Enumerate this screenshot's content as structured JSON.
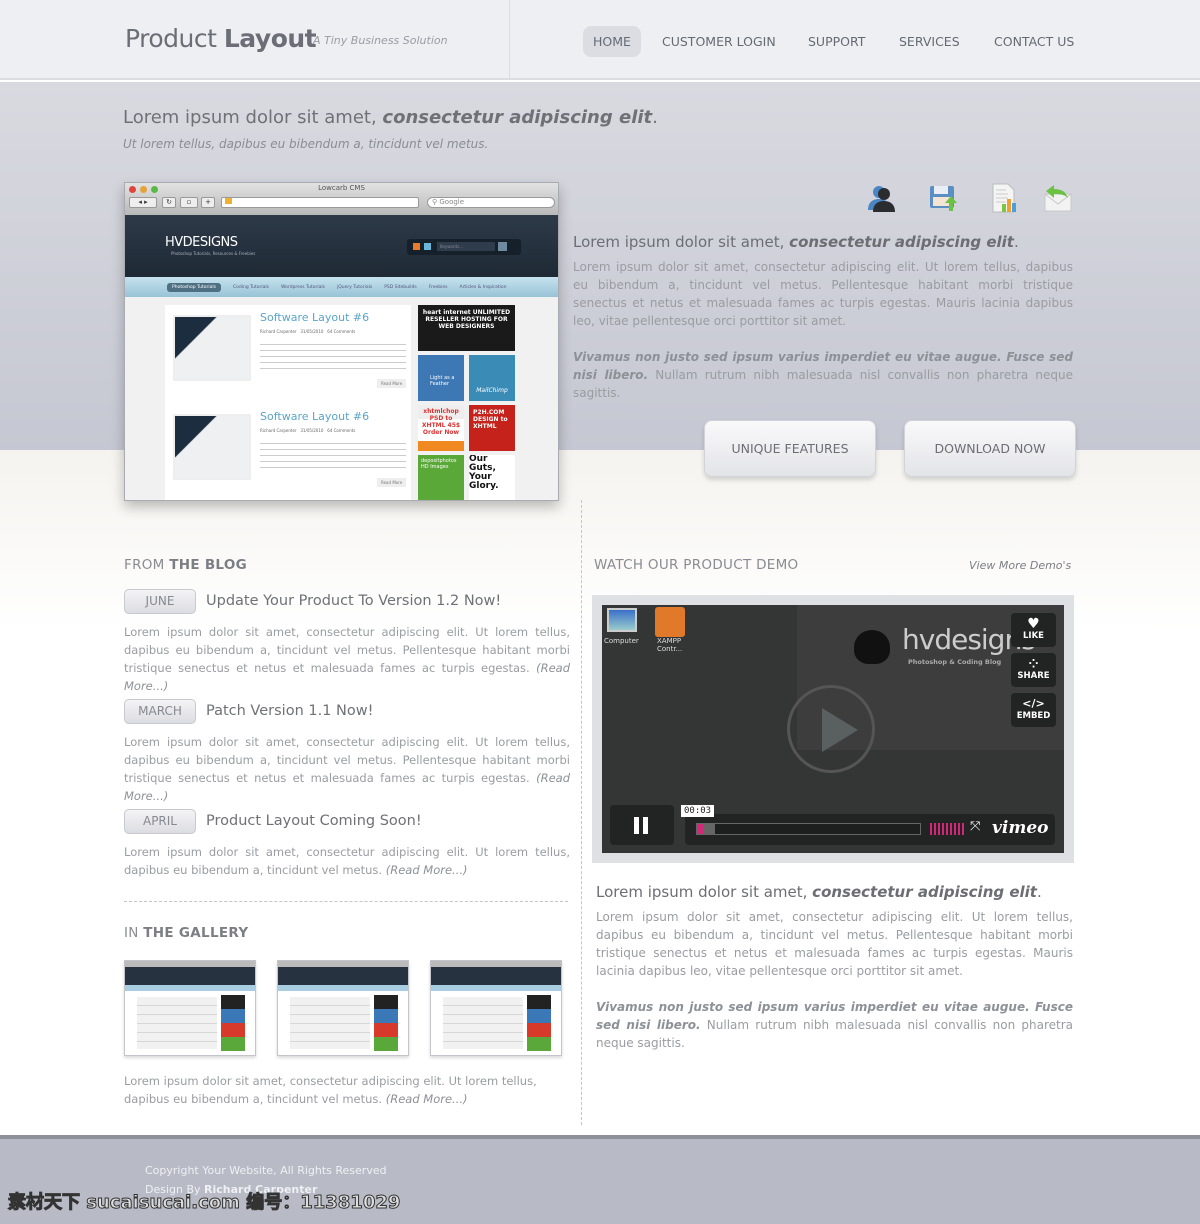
{
  "header": {
    "logo_light": "Product",
    "logo_bold": "Layout",
    "tagline": "A Tiny Business Solution",
    "nav": [
      {
        "label": "HOME",
        "active": true
      },
      {
        "label": "CUSTOMER LOGIN"
      },
      {
        "label": "SUPPORT"
      },
      {
        "label": "SERVICES"
      },
      {
        "label": "CONTACT US"
      }
    ]
  },
  "hero": {
    "headline_plain": "Lorem ipsum dolor sit amet, ",
    "headline_bold": "consectetur adipiscing elit",
    "headline_end": ".",
    "subheadline": "Ut lorem tellus, dapibus eu bibendum a, tincidunt vel metus.",
    "browser": {
      "title": "Lowcarb CMS",
      "search_placeholder": "Google",
      "site_logo": "HVDESIGNS",
      "site_tagline": "Photoshop Tutorials, Resources & Freebies",
      "site_search_placeholder": "Keywords...",
      "site_nav": [
        "Photoshop Tutorials",
        "Coding Tutorials",
        "Wordpress Tutorials",
        "jQuery Tutorials",
        "PSD Sitebuilds",
        "Freebies",
        "Articles & Inspiration"
      ],
      "posts": [
        {
          "title": "Software Layout #6",
          "author": "Richard Carpenter",
          "date": "31/05/2010",
          "comments": "64 Comments",
          "read_more": "Read More"
        },
        {
          "title": "Software Layout #6",
          "author": "Richard Carpenter",
          "date": "31/05/2010",
          "comments": "64 Comments",
          "read_more": "Read More"
        }
      ],
      "ads": [
        "heart internet UNLIMITED RESELLER HOSTING FOR WEB DESIGNERS",
        "Light as a Feather",
        "MailChimp",
        "xhtmlchop PSD to XHTML 45$ Order Now",
        "P2H.COM DESIGN to XHTML",
        "depositphotos HD Images",
        "Our Guts, Your Glory."
      ]
    },
    "icons": [
      "user-icon",
      "save-upload-icon",
      "report-chart-icon",
      "mail-reply-icon"
    ],
    "side_title_plain": "Lorem ipsum dolor sit amet, ",
    "side_title_bold": "consectetur adipiscing elit",
    "side_title_end": ".",
    "side_para1": "Lorem ipsum dolor sit amet, consectetur adipiscing elit. Ut lorem tellus, dapibus eu bibendum a, tincidunt vel metus. Pellentesque habitant morbi tristique senectus et netus et malesuada fames ac turpis egestas. Mauris lacinia dapibus leo, vitae pellentesque orci porttitor sit amet.",
    "side_para2_bold": "Vivamus non justo sed ipsum varius imperdiet eu vitae augue. Fusce sed nisi libero.",
    "side_para2": " Nullam rutrum nibh malesuada nisl convallis non pharetra neque sagittis.",
    "btn_features": "UNIQUE FEATURES",
    "btn_download": "DOWNLOAD NOW"
  },
  "blog": {
    "title_light": "FROM ",
    "title_bold": "THE BLOG",
    "posts": [
      {
        "month": "JUNE",
        "title": "Update Your Product To Version 1.2 Now!",
        "text": "Lorem ipsum dolor sit amet, consectetur adipiscing elit. Ut lorem tellus, dapibus eu bibendum a, tincidunt vel metus. Pellentesque habitant morbi tristique senectus et netus et malesuada fames ac turpis egestas.",
        "more": "(Read More...)"
      },
      {
        "month": "MARCH",
        "title": "Patch Version 1.1 Now!",
        "text": "Lorem ipsum dolor sit amet, consectetur adipiscing elit. Ut lorem tellus, dapibus eu bibendum a, tincidunt vel metus. Pellentesque habitant morbi tristique senectus et netus et malesuada fames ac turpis egestas.",
        "more": "(Read More...)"
      },
      {
        "month": "APRIL",
        "title": "Product Layout Coming Soon!",
        "text": "Lorem ipsum dolor sit amet, consectetur adipiscing elit. Ut lorem tellus, dapibus eu bibendum a, tincidunt vel metus.",
        "more": "(Read More...)"
      }
    ]
  },
  "gallery": {
    "title_light": "IN ",
    "title_bold": "THE GALLERY",
    "text": "Lorem ipsum dolor sit amet, consectetur adipiscing elit. Ut lorem tellus, dapibus eu bibendum a, tincidunt vel metus.",
    "more": "(Read More...)"
  },
  "demo": {
    "title": "WATCH OUR PRODUCT DEMO",
    "view_more": "View More Demo's",
    "video": {
      "desktop_icons": [
        "Computer",
        "XAMPP Contr..."
      ],
      "brand": "hvdesigns",
      "brand_sub": "Photoshop & Coding Blog",
      "like": "LIKE",
      "share": "SHARE",
      "embed": "EMBED",
      "time": "00:03",
      "progress": 0.03,
      "provider": "vimeo"
    },
    "title_plain": "Lorem ipsum dolor sit amet, ",
    "title_bold": "consectetur adipiscing elit",
    "title_end": ".",
    "para1": "Lorem ipsum dolor sit amet, consectetur adipiscing elit. Ut lorem tellus, dapibus eu bibendum a, tincidunt vel metus. Pellentesque habitant morbi tristique senectus et netus et malesuada fames ac turpis egestas. Mauris lacinia dapibus leo, vitae pellentesque orci porttitor sit amet.",
    "para2_bold": "Vivamus non justo sed ipsum varius imperdiet eu vitae augue. Fusce sed nisi libero.",
    "para2": " Nullam rutrum nibh malesuada nisl convallis non pharetra neque sagittis."
  },
  "footer": {
    "copyright": "Copyright Your Website, All Rights Reserved",
    "design_by": "Design By ",
    "designer": "Richard Carpenter"
  },
  "watermark": "素材天下 sucaisucai.com  编号：11381029"
}
